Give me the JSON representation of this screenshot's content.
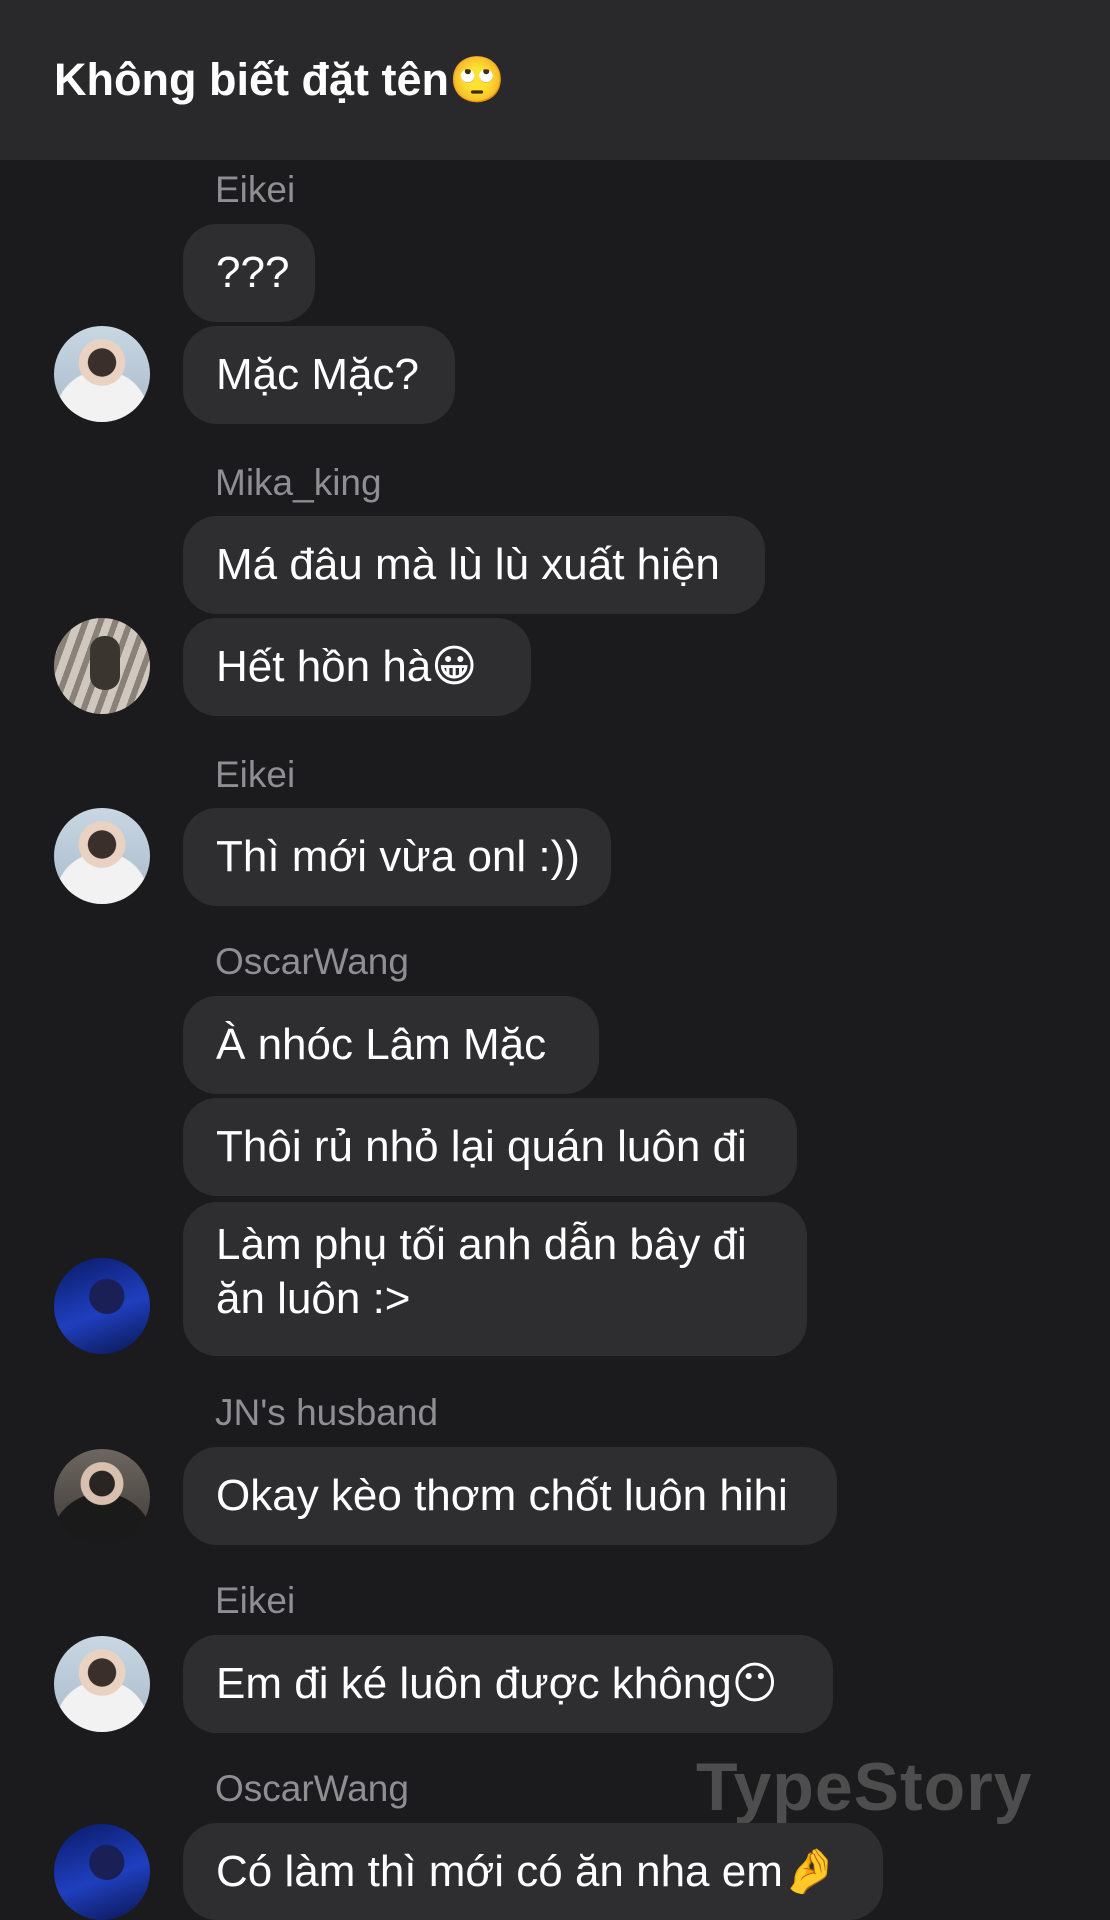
{
  "header": {
    "title": "Không biết đặt tên🙄"
  },
  "messages": {
    "g1": {
      "sender": "Eikei",
      "m1": "???",
      "m2": "Mặc Mặc?"
    },
    "g2": {
      "sender": "Mika_king",
      "m1": "Má đâu mà lù lù xuất hiện",
      "m2": "Hết hồn hà😀"
    },
    "g3": {
      "sender": "Eikei",
      "m1": "Thì mới vừa onl :))"
    },
    "g4": {
      "sender": "OscarWang",
      "m1": "À nhóc Lâm Mặc",
      "m2": "Thôi rủ nhỏ lại quán luôn đi",
      "m3": "Làm phụ tối anh dẫn bây đi ăn luôn :>"
    },
    "g5": {
      "sender": "JN's husband",
      "m1": "Okay kèo thơm chốt luôn hihi"
    },
    "g6": {
      "sender": "Eikei",
      "m1": "Em đi ké luôn được không😶"
    },
    "g7": {
      "sender": "OscarWang",
      "m1": "Có làm thì mới có ăn nha em🤌"
    }
  },
  "watermark": "TypeStory"
}
